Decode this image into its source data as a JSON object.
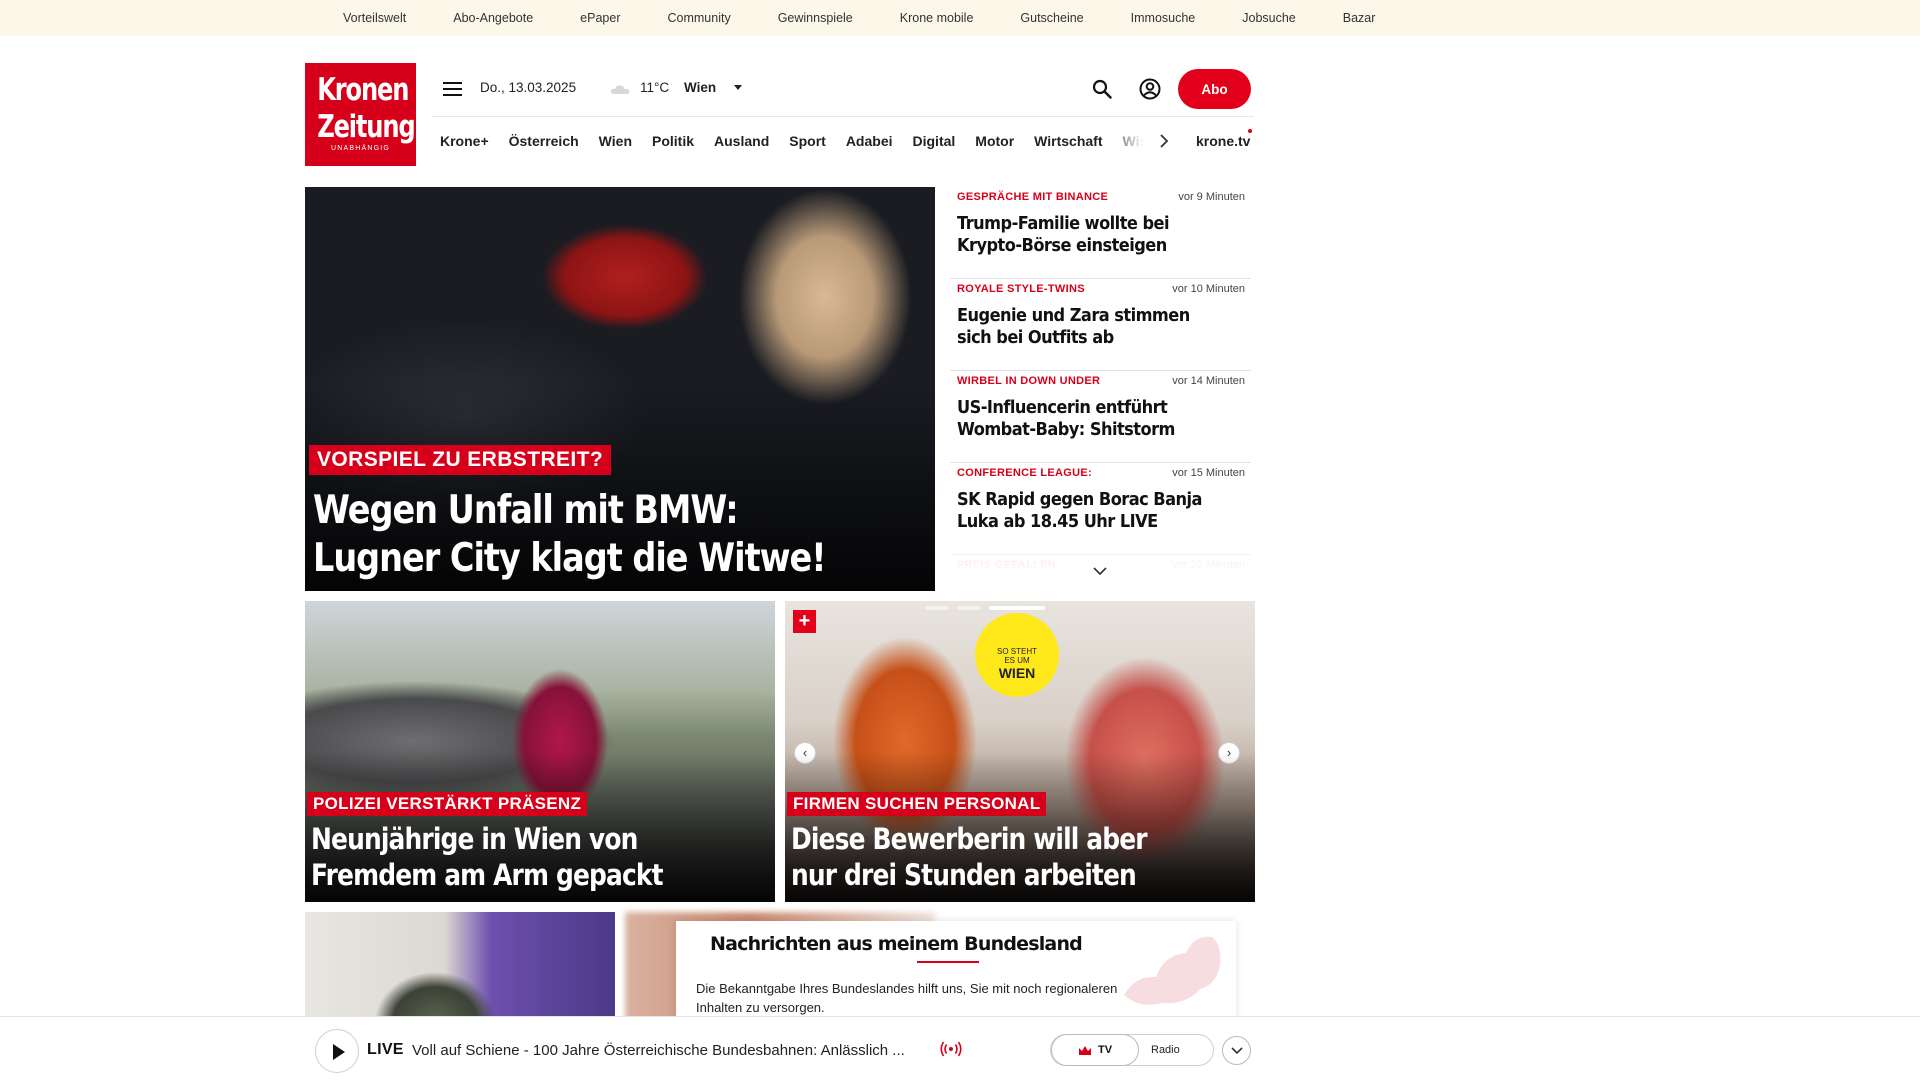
{
  "utility_nav": [
    "Vorteilswelt",
    "Abo-Angebote",
    "ePaper",
    "Community",
    "Gewinnspiele",
    "Krone mobile",
    "Gutscheine",
    "Immosuche",
    "Jobsuche",
    "Bazar"
  ],
  "logo": {
    "line1": "Kronen",
    "line2": "Zeitung",
    "tagline": "UNABHÄNGIG"
  },
  "header": {
    "date": "Do., 13.03.2025",
    "temperature": "11°C",
    "city": "Wien",
    "subscribe_label": "Abo"
  },
  "main_nav": {
    "items": [
      "Krone+",
      "Österreich",
      "Wien",
      "Politik",
      "Ausland",
      "Sport",
      "Adabei",
      "Digital",
      "Motor",
      "Wirtschaft",
      "Wissen"
    ],
    "tv_label": "krone.tv"
  },
  "hero": {
    "kicker": "VORSPIEL ZU ERBSTREIT?",
    "title_line1": "Wegen Unfall mit BMW:",
    "title_line2": "Lugner City klagt die Witwe!"
  },
  "news_list": [
    {
      "kicker": "GESPRÄCHE MIT BINANCE",
      "time": "vor 9 Minuten",
      "title": "Trump-Familie wollte bei Krypto-Börse einsteigen"
    },
    {
      "kicker": "ROYALE STYLE-TWINS",
      "time": "vor 10 Minuten",
      "title": "Eugenie und Zara stimmen sich bei Outfits ab"
    },
    {
      "kicker": "WIRBEL IN DOWN UNDER",
      "time": "vor 14 Minuten",
      "title": "US-Influencerin entführt Wombat-Baby: Shitstorm"
    },
    {
      "kicker": "CONFERENCE LEAGUE:",
      "time": "vor 15 Minuten",
      "title": "SK Rapid gegen Borac Banja Luka ab 18.45 Uhr LIVE"
    },
    {
      "kicker": "PREIS GEFALLEN",
      "time": "vor 22 Minuten",
      "title": ""
    }
  ],
  "teasers": [
    {
      "kicker": "POLIZEI VERSTÄRKT PRÄSENZ",
      "title_line1": "Neunjährige in Wien von",
      "title_line2": "Fremdem am Arm gepackt"
    },
    {
      "kicker": "FIRMEN SUCHEN PERSONAL",
      "title_line1": "Diese Bewerberin will aber",
      "title_line2": "nur drei Stunden arbeiten",
      "badge_line1": "SO STEHT",
      "badge_line2": "ES UM",
      "badge_city": "WIEN",
      "plus": "+"
    }
  ],
  "region_card": {
    "title": "Nachrichten aus meinem Bundesland",
    "text": "Die Bekanntgabe Ihres Bundeslandes hilft uns, Sie mit noch regionaleren Inhalten zu versorgen."
  },
  "live_bar": {
    "label": "LIVE",
    "title": "Voll auf Schiene - 100 Jahre Österreichische Bundesbahnen: Anlässlich ...",
    "tv_label": "TV",
    "radio_label": "Radio"
  },
  "colors": {
    "brand_red": "#d7001a",
    "utility_bg": "#fbf7e9"
  }
}
